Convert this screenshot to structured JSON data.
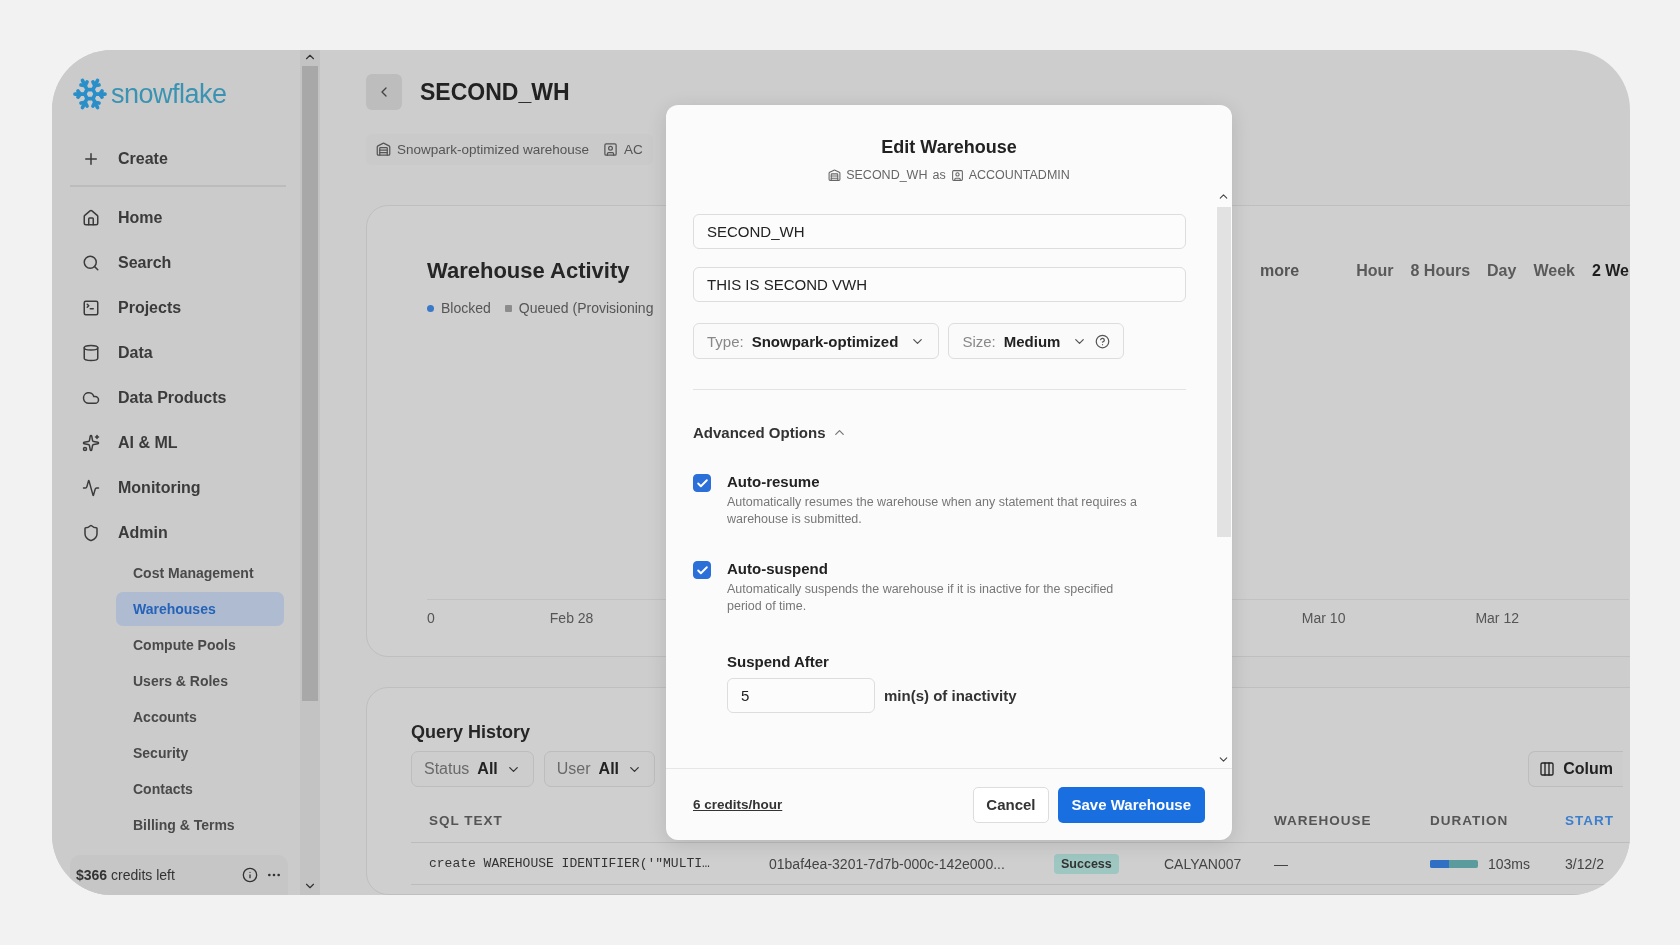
{
  "sidebar": {
    "logo": "snowflake",
    "create": "Create",
    "nav": [
      {
        "label": "Home"
      },
      {
        "label": "Search"
      },
      {
        "label": "Projects"
      },
      {
        "label": "Data"
      },
      {
        "label": "Data Products"
      },
      {
        "label": "AI & ML"
      },
      {
        "label": "Monitoring"
      },
      {
        "label": "Admin"
      }
    ],
    "sub_items": [
      {
        "label": "Cost Management",
        "selected": false
      },
      {
        "label": "Warehouses",
        "selected": true
      },
      {
        "label": "Compute Pools",
        "selected": false
      },
      {
        "label": "Users & Roles",
        "selected": false
      },
      {
        "label": "Accounts",
        "selected": false
      },
      {
        "label": "Security",
        "selected": false
      },
      {
        "label": "Contacts",
        "selected": false
      },
      {
        "label": "Billing & Terms",
        "selected": false
      }
    ],
    "credits": "**$366** credits left"
  },
  "page": {
    "title": "SECOND_WH",
    "chips": [
      "Snowpark-optimized warehouse",
      "AC"
    ]
  },
  "activity": {
    "title": "Warehouse Activity",
    "legend": [
      {
        "label": "Blocked",
        "color": "#3a78c9"
      },
      {
        "label": "Queued (Provisioning",
        "color": "#8c8c8c"
      }
    ],
    "more_link": "more",
    "ranges": [
      {
        "label": "Hour",
        "selected": false
      },
      {
        "label": "8 Hours",
        "selected": false
      },
      {
        "label": "Day",
        "selected": false
      },
      {
        "label": "Week",
        "selected": false
      },
      {
        "label": "2 We",
        "selected": true
      }
    ],
    "y_label": "0",
    "x_labels_left": [
      "Feb 28"
    ],
    "x_labels_right": [
      "Mar 10",
      "Mar 12"
    ]
  },
  "query_history": {
    "title": "Query History",
    "filters": [
      {
        "label": "Status",
        "value": "All"
      },
      {
        "label": "User",
        "value": "All"
      }
    ],
    "columns_button": "Colum",
    "headers": [
      {
        "label": "SQL TEXT",
        "sorted": false
      },
      {
        "label": "WAREHOUSE",
        "sorted": false
      },
      {
        "label": "DURATION",
        "sorted": false
      },
      {
        "label": "START",
        "sorted": true
      }
    ],
    "rows": [
      {
        "sql": "create WAREHOUSE IDENTIFIER('\"MULTI…",
        "query_id": "01baf4ea-3201-7d7b-000c-142e000...",
        "status": "Success",
        "user": "CALYAN007",
        "warehouse": "—",
        "duration": "103ms",
        "level": 0.4,
        "start": "3/12/2"
      }
    ]
  },
  "modal": {
    "title": "Edit Warehouse",
    "warehouse": "SECOND_WH",
    "as": "as",
    "role": "ACCOUNTADMIN",
    "name": "SECOND_WH",
    "comment": "THIS IS SECOND VWH",
    "selects": [
      {
        "label": "Type:",
        "value": "Snowpark-optimized",
        "help": false
      },
      {
        "label": "Size:",
        "value": "Medium",
        "help": true
      }
    ],
    "advanced": {
      "label": "Advanced Options",
      "expanded": true
    },
    "options": [
      {
        "label": "Auto-resume",
        "description": "Automatically resumes the warehouse when any statement that requires a warehouse is submitted.",
        "checked": true
      },
      {
        "label": "Auto-suspend",
        "description": "Automatically suspends the warehouse if it is inactive for the specified period of time.",
        "checked": true
      }
    ],
    "suspend": {
      "label": "Suspend After",
      "value": "5",
      "unit": "min(s) of inactivity"
    },
    "credits": "6 credits/hour",
    "cancel": "Cancel",
    "save": "Save Warehouse"
  }
}
